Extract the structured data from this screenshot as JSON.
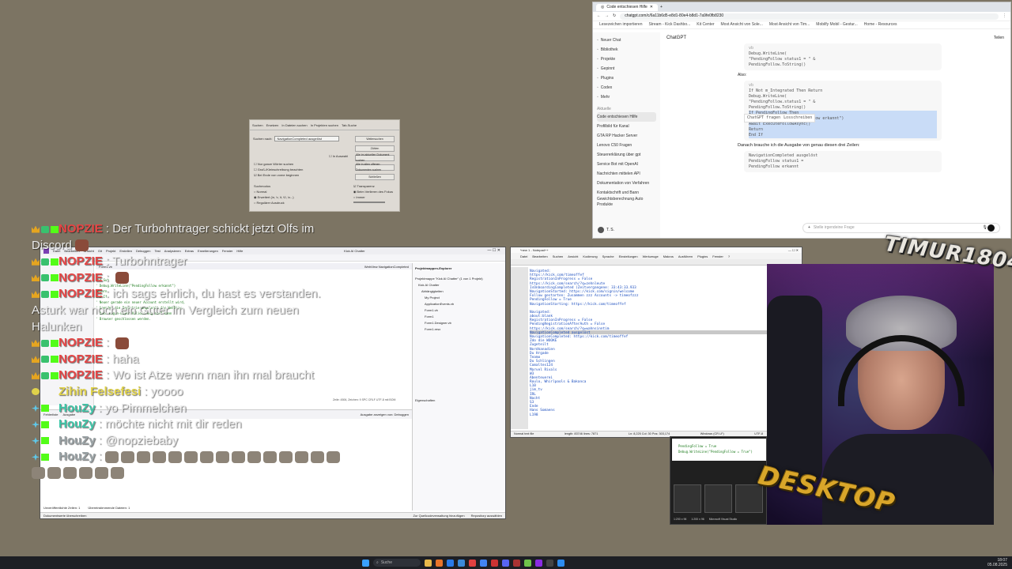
{
  "browser": {
    "tab_title": "Code entschiesen Hilfe",
    "url": "chatgpt.com/c/6a11b6d5-e8d1-80e4-b8d1-7a9fe0fb8230",
    "bookmarks": [
      "Lesezeichen importieren",
      "Stream - Kick Dashbo...",
      "Kit Center",
      "Most Ansicht von Sole...",
      "Most Ansicht von Tim...",
      "Mobilfy Mobil - Gestur...",
      "Home - Resources"
    ],
    "app_name": "ChatGPT",
    "share_label": "Teilen",
    "sidebar": {
      "items": [
        "Neuer Chat",
        "Bibliothek",
        "Projekte",
        "Gepinnt",
        "Plugins",
        "Codex",
        "Mehr"
      ],
      "section_label": "Aktuelle",
      "recent": [
        "Code entschiesen Hilfe",
        "Profilbild für Kanal",
        "GTA RP Hacker Server",
        "Lenovo C50 Fragen",
        "Steuererklärung über gpt",
        "Service Bot mit OpenAI",
        "Nachrichten mittelen API",
        "Dokumentation von Verfahren",
        "Kontaktschrift und Bann",
        "Gewichtsberechnung Auto Produkte"
      ],
      "user_initials": "T. S."
    },
    "chat": {
      "lang1": "vb",
      "code1": [
        "Debug.WriteLine(",
        "  \"PendingFollow status1 = \" &",
        "  PendingFollow.ToString()"
      ],
      "also_label": "Also:",
      "lang2": "vb",
      "code2": [
        "If Not m_Integrated Then Return",
        "Debug.WriteLine(",
        "  \"PendingFollow.status1 = \" &",
        "  PendingFollow.ToString()",
        "If PendingFollow Then",
        "  Debug.WriteLine(\"PendingFollow erkannt\")",
        "  Await ExecuteFollowAsync()",
        "  Return",
        "End If"
      ],
      "tooltip_ask": "ChatGPT fragen",
      "tooltip_delete": "Losschreiben",
      "after_text": "Danach brauche ich die Ausgabe von genau diesen drei Zeilen:",
      "code3": [
        "NavigationCompleted ausgelöst",
        "PendingFollow status1 =",
        "PendingFollow erkannt"
      ],
      "prompt_placeholder": "Stelle irgendeine Frage"
    }
  },
  "find_dialog": {
    "tabs": [
      "Suchen",
      "Ersetzen",
      "In Dateien suchen",
      "In Projekten suchen",
      "Tab-Suche"
    ],
    "search_label": "Suchen nach:",
    "search_value": "NavigationCompleted ausgelöst",
    "buttons": [
      "Weitersuchen",
      "Zählen",
      "Alle im aktuellen Dokument suchen",
      "Alle in allen offenen Dokumenten suchen",
      "Schließen"
    ],
    "checkboxes": [
      "Nur ganze Wörter suchen",
      "Groß-/Kleinschreibung beachten",
      "Bei Ende von vorne beginnen"
    ],
    "in_selection": "In Auswahl",
    "mode_label": "Suchmodus",
    "modes": [
      "Normal",
      "Erweitert (\\n, \\r, \\t, \\0, \\x...)",
      "Regulärer Ausdruck"
    ],
    "transparency": "Transparenz",
    "transparency_opts": [
      "Beim Verlieren des Fokus",
      "Immer"
    ]
  },
  "vs": {
    "title": "Kick AI Chatter",
    "menu": [
      "Datei",
      "Bearbeiten",
      "Ansicht",
      "Git",
      "Projekt",
      "Erstellen",
      "Debuggen",
      "Test",
      "Analysieren",
      "Extras",
      "Erweiterungen",
      "Fenster",
      "Hilfe"
    ],
    "tab": "Form1.vb",
    "breadcrumb": "WebView NavigationCompleted",
    "code_lines": [
      "End Sub",
      "' Debug.WriteLine(\"PendingFollow erkannt\")",
      "Return",
      "End If",
      "' Neuer gerade ein neuer Account erstellt wird,",
      "' beenden die Registrierungslogin die WebView.",
      "' Nach Login-Layer-Validierung darf dann",
      "' Browser geschlossen werden."
    ],
    "status_line": "Zeile: 4506, Zeichen: 9  SPC  CRLF  UTF-8 mit BOM",
    "solution_title": "Projektmappen-Explorer",
    "solution_items": [
      "Projektmappe \"Kick AI Chatter\" (1 von 1 Projekt)",
      "Kick AI Chatter",
      "Abhängigkeiten",
      "My Project",
      "ApplicationEvents.vb",
      "Form1.vb",
      "Form1",
      "Form1.Designer.vb",
      "Form1.resx"
    ],
    "properties_label": "Eigenschaften",
    "error_tabs": [
      "Fehlerliste",
      "Ausgabe"
    ],
    "bottom_bar": [
      "Unveröffentlichte Zeilen: 1",
      "Übereinstimmende Dateien: 1"
    ],
    "output_label": "Ausgabe anzeigen von: Debuggen",
    "statusbar_left": "Dokumentwerte überschreiben",
    "statusbar_right": "Zur Quellcodeverwaltung hinzufügen",
    "repo": "Repository auswählen"
  },
  "npp": {
    "title": "*new 1 - Notepad++",
    "menu": [
      "Datei",
      "Bearbeiten",
      "Suchen",
      "Ansicht",
      "Kodierung",
      "Sprache",
      "Einstellungen",
      "Werkzeuge",
      "Makros",
      "Ausführen",
      "Plugins",
      "Fenster",
      "?"
    ],
    "lines": [
      "Navigated:",
      "https://kick.com/timeoffef",
      "RegistrationInProgress = False",
      "https://kick.com/search/?q=zehnleute",
      "IsOnboardingCompleted (Zeitvergangene: 33:43:33.933",
      "NavigationStarted: https://kick.com/signin/welcome",
      "Follow gestarten: Zusammen zzz Accounts -> timeofzzz",
      "PendingFollow = True",
      "NavigationStarting: https://kick.com/timeoffef",
      "",
      "Navigated:",
      "about:blank",
      "RegistrationInProgress = False",
      "PendingRegistrationAfterAuth = False",
      "https://kick.com/search/?q=wahnsinntim",
      "NavigationCompleted ausgelöst",
      "NavigationCompleted: https://kick.com/timeoffef",
      "Zdo die WOOKE",
      "Zugeteilt",
      "Nordkanadien",
      "Du Hrgade",
      "Teamo",
      "Du Schlingen",
      "Comaltes124",
      "Marvel Rivals",
      "W3",
      "Abenteuerei",
      "Roulo, Whirlpools & Bakanca",
      "L10",
      "jim_tv",
      "IRL",
      "Nacht",
      "S3",
      "Ende",
      "Hans Somaens",
      "L198"
    ],
    "highlight_index": 15,
    "status": [
      "Normal text file",
      "length: 83746  lines: 7871",
      "Ln: 8,225  Col: 30  Pos: 303,174",
      "Windows (CR LF)",
      "UTF-8",
      "INS"
    ]
  },
  "preview": {
    "code": [
      "PendingFollow = True",
      "Debug.WriteLine(\"PendingFollow = True\")"
    ],
    "labels": [
      "1:200 x 96",
      "1:200 x 96",
      "Microsoft Visual Studio"
    ]
  },
  "overlay": {
    "logo_top": "TIMUR1804",
    "logo_bottom": "DESKTOP"
  },
  "chat_overlay": {
    "messages": [
      {
        "user": "NOPZIE",
        "user_color": "#e64545",
        "text": "Der Turbohntrager schickt jetzt Olfs im",
        "badge": "crown"
      },
      {
        "user": "",
        "user_color": "#e64545",
        "text": "Discord",
        "badge": "none"
      },
      {
        "user": "NOPZIE",
        "user_color": "#e64545",
        "text": "Turbohntrager",
        "badge": "crown"
      },
      {
        "user": "NOPZIE",
        "user_color": "#e64545",
        "text": "",
        "badge": "crown"
      },
      {
        "user": "NOPZIE",
        "user_color": "#e64545",
        "text": "ich sags ehrlich, du hast es verstanden.",
        "badge": "crown"
      },
      {
        "user": "",
        "user_color": "#e64545",
        "text": "Asturk war noch ein Guter im Vergleich zum neuen",
        "badge": "none"
      },
      {
        "user": "",
        "user_color": "#e64545",
        "text": "Halunken",
        "badge": "none"
      },
      {
        "user": "NOPZIE",
        "user_color": "#e64545",
        "text": "",
        "badge": "crown"
      },
      {
        "user": "NOPZIE",
        "user_color": "#e64545",
        "text": "haha",
        "badge": "crown"
      },
      {
        "user": "NOPZIE",
        "user_color": "#e64545",
        "text": "Wo ist Atze wenn man ihn mal braucht",
        "badge": "crown"
      },
      {
        "user": "Zihin Felsefesi",
        "user_color": "#e0d24a",
        "text": "yoooo",
        "badge": "note"
      },
      {
        "user": "HouZy",
        "user_color": "#3ec6a8",
        "text": "yo Pimmelchen",
        "badge": "star"
      },
      {
        "user": "HouZy",
        "user_color": "#3ec6a8",
        "text": "möchte nicht mit dir reden",
        "badge": "star"
      },
      {
        "user": "HouZy",
        "user_color": "#9aa3a6",
        "text": "@nopziebaby",
        "badge": "star"
      },
      {
        "user": "HouZy",
        "user_color": "#9aa3a6",
        "text": "",
        "badge": "star"
      }
    ],
    "colors": {
      "crown": "#e5a520",
      "shield": "#39c16e",
      "kick": "#53fc18",
      "star": "#5fc7e8",
      "note": "#e0d24a"
    }
  },
  "taskbar": {
    "search_label": "Suche",
    "time": "18:07",
    "date": "05.08.2025"
  }
}
